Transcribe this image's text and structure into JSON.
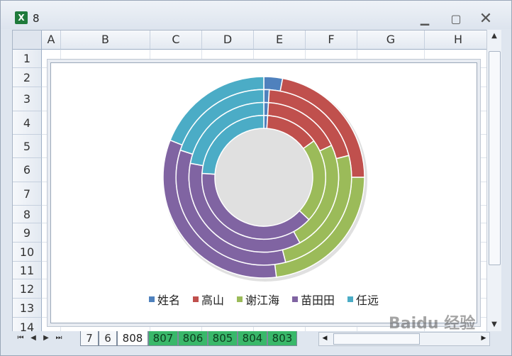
{
  "window": {
    "title": "8",
    "app_icon": "excel-icon"
  },
  "columns": [
    "A",
    "B",
    "C",
    "D",
    "E",
    "F",
    "G",
    "H"
  ],
  "rows": [
    "1",
    "2",
    "3",
    "4",
    "5",
    "6",
    "7",
    "8",
    "9",
    "10",
    "11",
    "12",
    "13",
    "14"
  ],
  "chart_data": {
    "type": "doughnut",
    "title": "",
    "categories": [
      "姓名",
      "高山",
      "谢江海",
      "苗田田",
      "任远"
    ],
    "colors": [
      "#4f81bd",
      "#c0504d",
      "#9bbb59",
      "#8064a2",
      "#4bacc6"
    ],
    "series": [
      {
        "values": [
          3,
          22,
          23,
          33,
          19
        ]
      },
      {
        "values": [
          1,
          20,
          25,
          34,
          20
        ]
      },
      {
        "values": [
          1,
          17,
          24,
          36,
          22
        ]
      },
      {
        "values": [
          1,
          14,
          22,
          39,
          24
        ]
      }
    ],
    "legend_position": "bottom"
  },
  "sheet_tabs": [
    {
      "label": "7",
      "style": "plain"
    },
    {
      "label": "6",
      "style": "plain"
    },
    {
      "label": "808",
      "style": "active"
    },
    {
      "label": "807",
      "style": "green"
    },
    {
      "label": "806",
      "style": "green"
    },
    {
      "label": "805",
      "style": "green"
    },
    {
      "label": "804",
      "style": "green"
    },
    {
      "label": "803",
      "style": "green"
    }
  ],
  "watermark": "Baidu 经验"
}
